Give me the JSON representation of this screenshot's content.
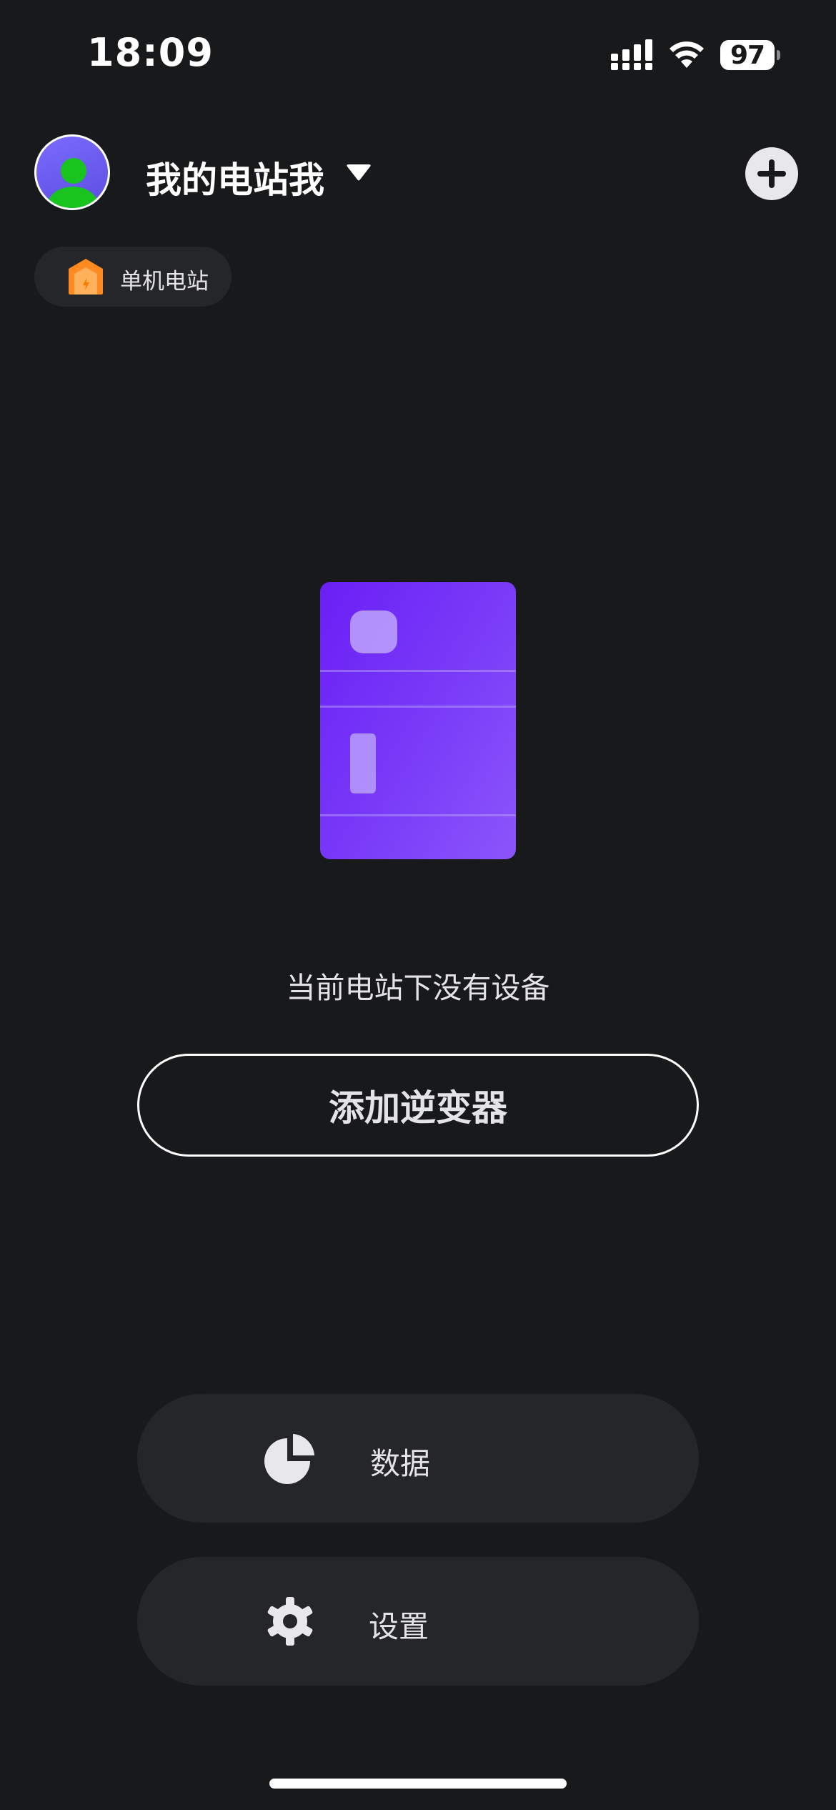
{
  "status_bar": {
    "time": "18:09",
    "battery": "97"
  },
  "header": {
    "station_name": "我的电站我",
    "avatar_icon": "user-avatar-icon",
    "dropdown_icon": "caret-down-icon",
    "add_icon": "plus-icon"
  },
  "station_chip": {
    "label": "单机电站",
    "icon": "house-icon"
  },
  "empty_state": {
    "illustration": "inverter-device-illustration",
    "message": "当前电站下没有设备",
    "add_button_label": "添加逆变器"
  },
  "actions": [
    {
      "label": "数据",
      "icon": "pie-chart-icon"
    },
    {
      "label": "设置",
      "icon": "gear-icon"
    }
  ],
  "colors": {
    "background": "#18191b",
    "pill_background": "#252629",
    "device_purple": "#6a1ff5",
    "chip_orange": "#ff8a1f"
  }
}
